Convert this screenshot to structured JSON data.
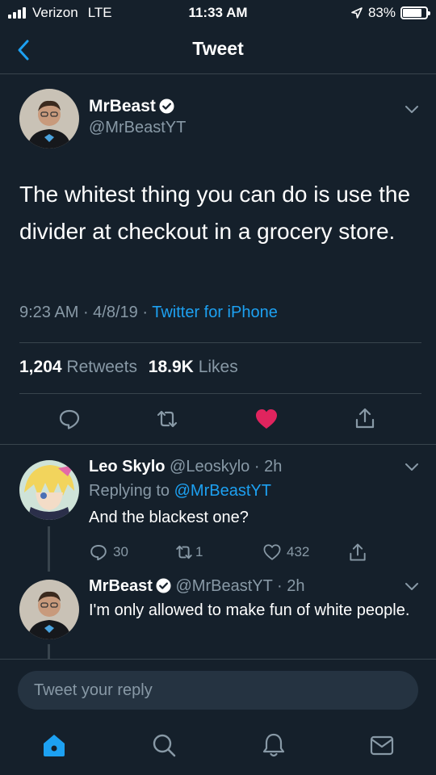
{
  "status_bar": {
    "carrier": "Verizon",
    "network": "LTE",
    "time": "11:33 AM",
    "battery": "83%",
    "battery_level": 0.83
  },
  "header": {
    "title": "Tweet"
  },
  "tweet": {
    "author_name": "MrBeast",
    "author_handle": "@MrBeastYT",
    "text": "The whitest thing you can do is use the divider at checkout in a grocery store.",
    "time": "9:23 AM",
    "date": "4/8/19",
    "source": "Twitter for iPhone",
    "retweets_count": "1,204",
    "retweets_label": "Retweets",
    "likes_count": "18.9K",
    "likes_label": "Likes"
  },
  "replies": [
    {
      "name": "Leo Skylo",
      "handle": "@Leoskylo",
      "age": "2h",
      "replying_prefix": "Replying to",
      "replying_to": "@MrBeastYT",
      "text": "And the blackest one?",
      "reply_count": "30",
      "retweet_count": "1",
      "like_count": "432"
    },
    {
      "name": "MrBeast",
      "handle": "@MrBeastYT",
      "age": "2h",
      "text": "I'm only allowed to make fun of white people."
    }
  ],
  "compose": {
    "placeholder": "Tweet your reply"
  },
  "colors": {
    "background": "#15202b",
    "accent": "#1da1f2",
    "like": "#e0245e",
    "muted": "#8899a6",
    "divider": "#38444d"
  }
}
